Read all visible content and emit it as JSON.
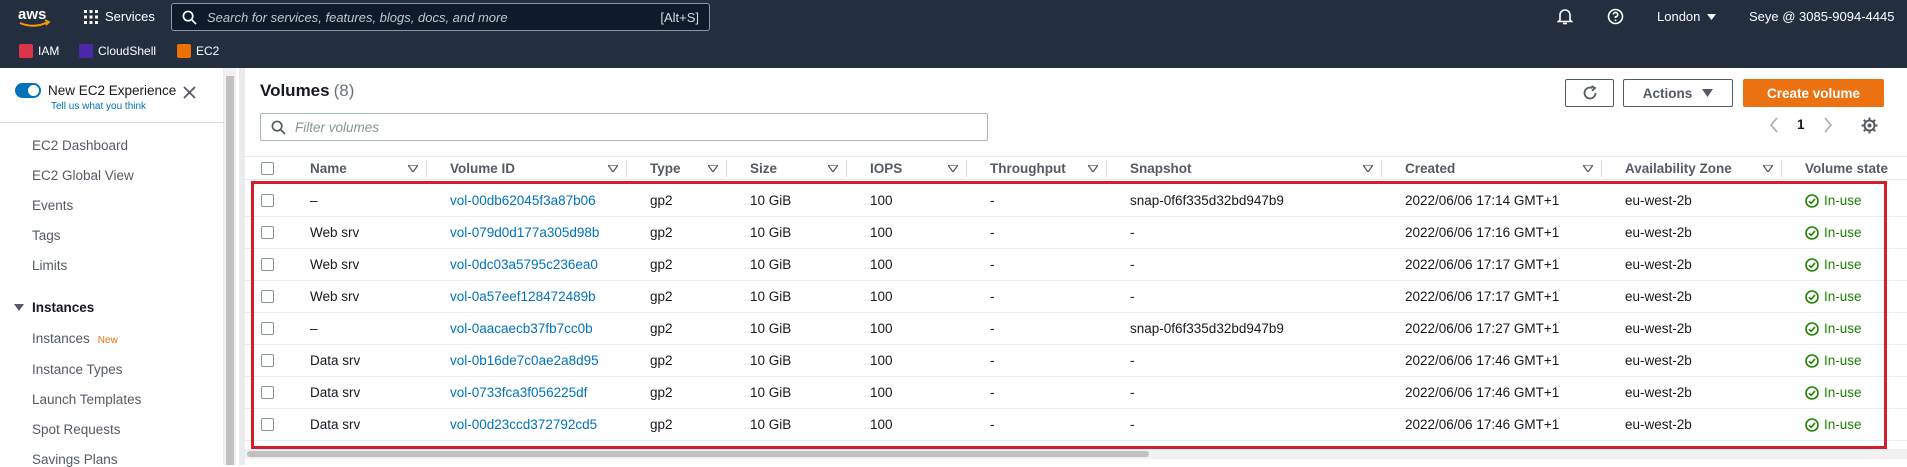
{
  "topnav": {
    "logo_text": "aws",
    "services_label": "Services",
    "search_placeholder": "Search for services, features, blogs, docs, and more",
    "search_shortcut": "[Alt+S]",
    "region": "London",
    "account": "Seye @ 3085-9094-4445"
  },
  "favorites": [
    {
      "label": "IAM",
      "color": "#dd344c"
    },
    {
      "label": "CloudShell",
      "color": "#4d27aa"
    },
    {
      "label": "EC2",
      "color": "#ed7100"
    }
  ],
  "sidebar": {
    "new_experience": "New EC2 Experience",
    "tell_us": "Tell us what you think",
    "items": [
      "EC2 Dashboard",
      "EC2 Global View",
      "Events",
      "Tags",
      "Limits"
    ],
    "section": "Instances",
    "section_items": [
      "Instances",
      "Instance Types",
      "Launch Templates",
      "Spot Requests",
      "Savings Plans"
    ],
    "new_badge": "New"
  },
  "main": {
    "title": "Volumes",
    "count": "(8)",
    "actions_label": "Actions",
    "create_label": "Create volume",
    "filter_placeholder": "Filter volumes",
    "page_number": "1"
  },
  "table": {
    "columns": [
      "Name",
      "Volume ID",
      "Type",
      "Size",
      "IOPS",
      "Throughput",
      "Snapshot",
      "Created",
      "Availability Zone",
      "Volume state"
    ],
    "rows": [
      {
        "name": "–",
        "volume_id": "vol-00db62045f3a87b06",
        "type": "gp2",
        "size": "10 GiB",
        "iops": "100",
        "throughput": "-",
        "snapshot": "snap-0f6f335d32bd947b9",
        "created": "2022/06/06 17:14 GMT+1",
        "zone": "eu-west-2b",
        "state": "In-use"
      },
      {
        "name": "Web srv",
        "volume_id": "vol-079d0d177a305d98b",
        "type": "gp2",
        "size": "10 GiB",
        "iops": "100",
        "throughput": "-",
        "snapshot": "-",
        "created": "2022/06/06 17:16 GMT+1",
        "zone": "eu-west-2b",
        "state": "In-use"
      },
      {
        "name": "Web srv",
        "volume_id": "vol-0dc03a5795c236ea0",
        "type": "gp2",
        "size": "10 GiB",
        "iops": "100",
        "throughput": "-",
        "snapshot": "-",
        "created": "2022/06/06 17:17 GMT+1",
        "zone": "eu-west-2b",
        "state": "In-use"
      },
      {
        "name": "Web srv",
        "volume_id": "vol-0a57eef128472489b",
        "type": "gp2",
        "size": "10 GiB",
        "iops": "100",
        "throughput": "-",
        "snapshot": "-",
        "created": "2022/06/06 17:17 GMT+1",
        "zone": "eu-west-2b",
        "state": "In-use"
      },
      {
        "name": "–",
        "volume_id": "vol-0aacaecb37fb7cc0b",
        "type": "gp2",
        "size": "10 GiB",
        "iops": "100",
        "throughput": "-",
        "snapshot": "snap-0f6f335d32bd947b9",
        "created": "2022/06/06 17:27 GMT+1",
        "zone": "eu-west-2b",
        "state": "In-use"
      },
      {
        "name": "Data srv",
        "volume_id": "vol-0b16de7c0ae2a8d95",
        "type": "gp2",
        "size": "10 GiB",
        "iops": "100",
        "throughput": "-",
        "snapshot": "-",
        "created": "2022/06/06 17:46 GMT+1",
        "zone": "eu-west-2b",
        "state": "In-use"
      },
      {
        "name": "Data srv",
        "volume_id": "vol-0733fca3f056225df",
        "type": "gp2",
        "size": "10 GiB",
        "iops": "100",
        "throughput": "-",
        "snapshot": "-",
        "created": "2022/06/06 17:46 GMT+1",
        "zone": "eu-west-2b",
        "state": "In-use"
      },
      {
        "name": "Data srv",
        "volume_id": "vol-00d23ccd372792cd5",
        "type": "gp2",
        "size": "10 GiB",
        "iops": "100",
        "throughput": "-",
        "snapshot": "-",
        "created": "2022/06/06 17:46 GMT+1",
        "zone": "eu-west-2b",
        "state": "In-use"
      }
    ]
  }
}
